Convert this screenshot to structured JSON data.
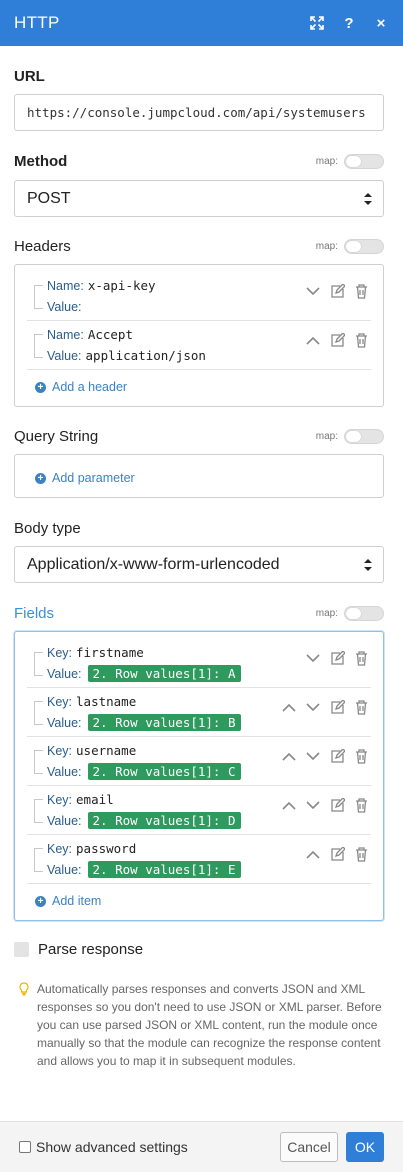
{
  "header": {
    "title": "HTTP",
    "icons": [
      "expand-icon",
      "help-icon",
      "close-icon"
    ],
    "help_glyph": "?",
    "close_glyph": "×"
  },
  "url": {
    "label": "URL",
    "value": "https://console.jumpcloud.com/api/systemusers"
  },
  "map_label": "map:",
  "method": {
    "label": "Method",
    "value": "POST"
  },
  "headers": {
    "label": "Headers",
    "items": [
      {
        "name_label": "Name:",
        "name": "x-api-key",
        "value_label": "Value:",
        "value": ""
      },
      {
        "name_label": "Name:",
        "name": "Accept",
        "value_label": "Value:",
        "value": "application/json"
      }
    ],
    "add_label": "Add a header"
  },
  "query": {
    "label": "Query String",
    "add_label": "Add parameter"
  },
  "body_type": {
    "label": "Body type",
    "value": "Application/x-www-form-urlencoded"
  },
  "fields": {
    "label": "Fields",
    "items": [
      {
        "key_label": "Key:",
        "key": "firstname",
        "value_label": "Value:",
        "value": "2. Row values[1]: A"
      },
      {
        "key_label": "Key:",
        "key": "lastname",
        "value_label": "Value:",
        "value": "2. Row values[1]: B"
      },
      {
        "key_label": "Key:",
        "key": "username",
        "value_label": "Value:",
        "value": "2. Row values[1]: C"
      },
      {
        "key_label": "Key:",
        "key": "email",
        "value_label": "Value:",
        "value": "2. Row values[1]: D"
      },
      {
        "key_label": "Key:",
        "key": "password",
        "value_label": "Value:",
        "value": "2. Row values[1]: E"
      }
    ],
    "add_label": "Add item"
  },
  "parse": {
    "label": "Parse response",
    "help": "Automatically parses responses and converts JSON and XML responses so you don't need to use JSON or XML parser. Before you can use parsed JSON or XML content, run the module once manually so that the module can recognize the response content and allows you to map it in subsequent modules."
  },
  "footer": {
    "advanced_label": "Show advanced settings",
    "cancel_label": "Cancel",
    "ok_label": "OK"
  },
  "colors": {
    "header_bg": "#2f7fd8",
    "link_blue": "#3a82c4",
    "tag_green": "#2f9a5e",
    "fields_focus_border": "#8fc0ec"
  }
}
